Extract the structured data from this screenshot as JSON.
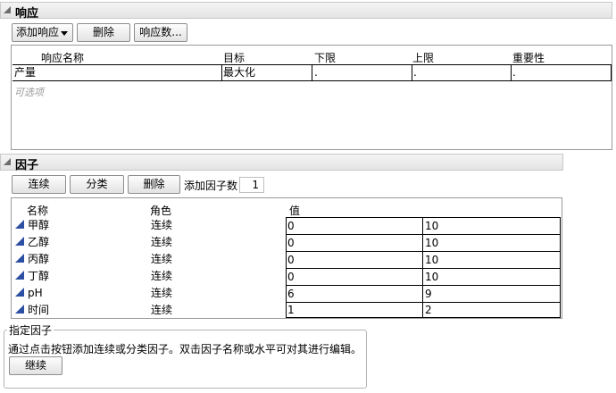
{
  "response": {
    "title": "响应",
    "add_response_label": "添加响应",
    "delete_label": "删除",
    "response_count_label": "响应数...",
    "columns": [
      "响应名称",
      "目标",
      "下限",
      "上限",
      "重要性"
    ],
    "rows": [
      {
        "name": "产量",
        "goal": "最大化",
        "lower": ".",
        "upper": ".",
        "importance": "."
      }
    ],
    "optional_label": "可选项"
  },
  "factors": {
    "title": "因子",
    "continuous_label": "连续",
    "categorical_label": "分类",
    "delete_label": "删除",
    "add_factor_count_label": "添加因子数",
    "add_factor_count_value": "1",
    "columns": [
      "名称",
      "角色",
      "值"
    ],
    "rows": [
      {
        "name": "甲醇",
        "role": "连续",
        "low": "0",
        "high": "10"
      },
      {
        "name": "乙醇",
        "role": "连续",
        "low": "0",
        "high": "10"
      },
      {
        "name": "丙醇",
        "role": "连续",
        "low": "0",
        "high": "10"
      },
      {
        "name": "丁醇",
        "role": "连续",
        "low": "0",
        "high": "10"
      },
      {
        "name": "pH",
        "role": "连续",
        "low": "6",
        "high": "9"
      },
      {
        "name": "时间",
        "role": "连续",
        "low": "1",
        "high": "2"
      }
    ]
  },
  "specify": {
    "legend": "指定因子",
    "instructions": "通过点击按钮添加连续或分类因子。双击因子名称或水平可对其进行编辑。",
    "continue_label": "继续"
  },
  "icons": {
    "disclosure": "disclosure-triangle-icon",
    "factor": "continuous-factor-icon",
    "dropdown": "dropdown-arrow-icon"
  },
  "colors": {
    "factor_icon": "#2c4fa3"
  }
}
